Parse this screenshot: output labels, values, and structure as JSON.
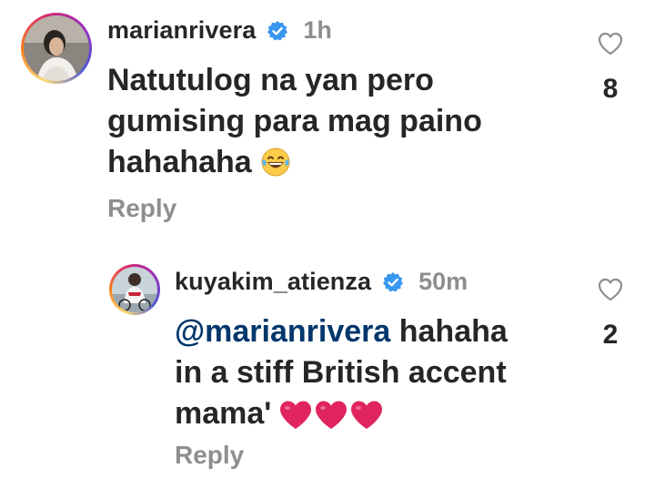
{
  "comments": [
    {
      "username": "marianrivera",
      "time": "1h",
      "text_lines": [
        "Natutulog na yan pero",
        "gumising para mag paino",
        "hahahaha"
      ],
      "emoji": "face-with-tears-of-joy",
      "reply_label": "Reply",
      "likes": "8"
    },
    {
      "username": "kuyakim_atienza",
      "time": "50m",
      "mention": "@marianrivera",
      "text_after_mention": " hahaha",
      "text_lines": [
        "in a stiff British accent",
        "mama'"
      ],
      "emoji": "red-heart x3",
      "reply_label": "Reply",
      "likes": "2"
    }
  ],
  "colors": {
    "text": "#262626",
    "secondary": "#8e8e8e",
    "verified": "#3897f0",
    "mention": "#00376b",
    "heart": "#e0245e"
  }
}
